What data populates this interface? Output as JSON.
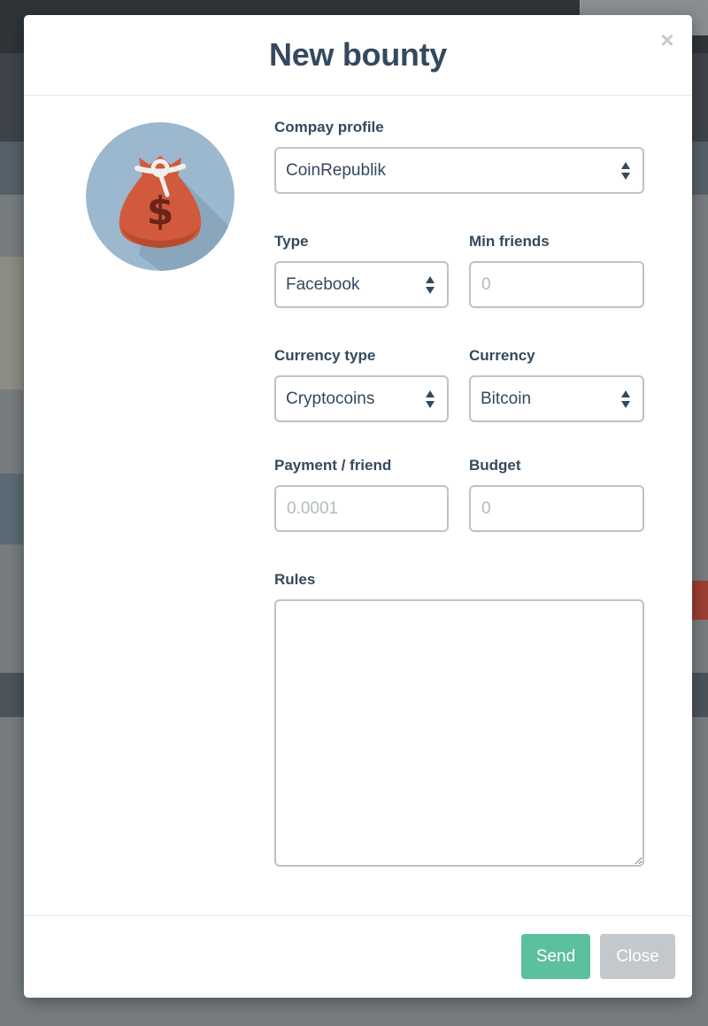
{
  "modal": {
    "title": "New bounty",
    "close_glyph": "×",
    "avatar_icon": "money-bag-icon"
  },
  "form": {
    "company_profile": {
      "label": "Compay profile",
      "value": "CoinRepublik"
    },
    "type": {
      "label": "Type",
      "value": "Facebook"
    },
    "min_friends": {
      "label": "Min friends",
      "placeholder": "0"
    },
    "currency_type": {
      "label": "Currency type",
      "value": "Cryptocoins"
    },
    "currency": {
      "label": "Currency",
      "value": "Bitcoin"
    },
    "payment_per_friend": {
      "label": "Payment / friend",
      "placeholder": "0.0001"
    },
    "budget": {
      "label": "Budget",
      "placeholder": "0"
    },
    "rules": {
      "label": "Rules",
      "placeholder": ""
    }
  },
  "footer": {
    "send_label": "Send",
    "close_label": "Close"
  },
  "colors": {
    "primary_text": "#34495e",
    "send_button": "#5cbf9e",
    "close_button": "#c2c8cb",
    "avatar_bg": "#9bb8cf",
    "bag": "#d15a3c"
  }
}
